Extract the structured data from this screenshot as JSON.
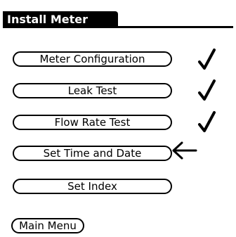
{
  "header": {
    "title": "Install Meter"
  },
  "menu": {
    "items": [
      {
        "label": "Meter Configuration",
        "status": "complete"
      },
      {
        "label": "Leak Test",
        "status": "complete"
      },
      {
        "label": "Flow Rate Test",
        "status": "complete"
      },
      {
        "label": "Set Time and Date",
        "status": "current"
      },
      {
        "label": "Set Index",
        "status": "pending"
      }
    ]
  },
  "footer": {
    "main_menu_label": "Main Menu"
  },
  "icons": {
    "complete": "checkmark-icon",
    "current": "left-arrow-icon"
  }
}
